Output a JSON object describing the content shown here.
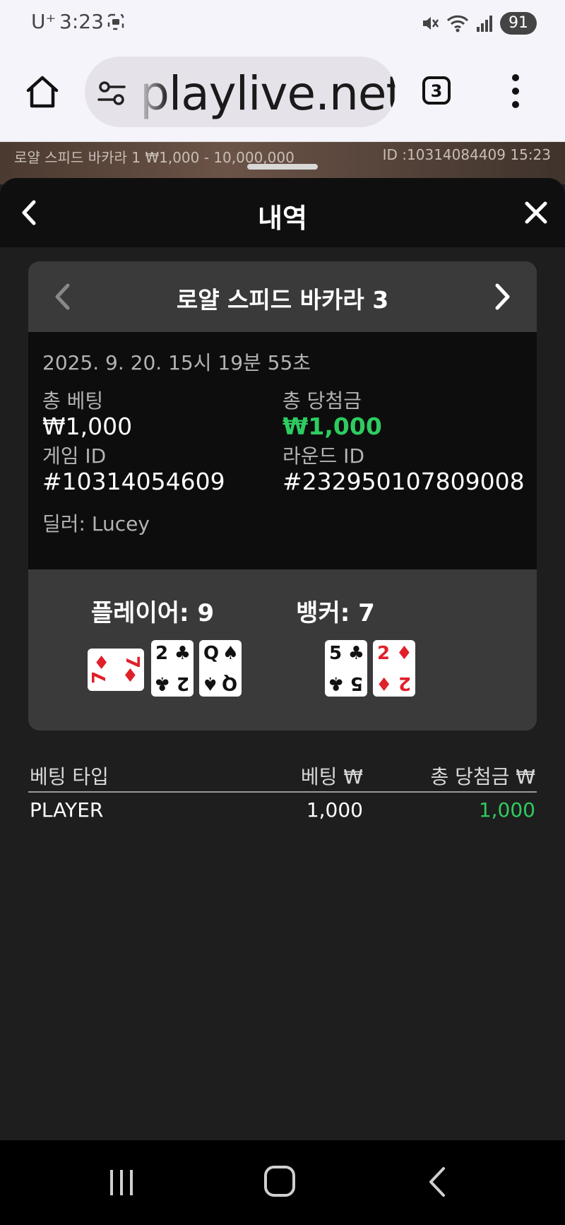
{
  "status_bar": {
    "carrier": "U⁺",
    "time": "3:23",
    "battery": "91"
  },
  "browser": {
    "url": "playlive.net",
    "tab_count": "3"
  },
  "game_strip": {
    "left_text": "로얄 스피드 바카라 1 ₩1,000 - 10,000,000",
    "right_text": "ID :10314084409 15:23"
  },
  "sheet": {
    "title": "내역"
  },
  "round": {
    "table_name": "로얄 스피드 바카라 3",
    "datetime": "2025. 9. 20. 15시 19분 55초",
    "total_bet_label": "총 베팅",
    "total_bet_value": "₩1,000",
    "total_win_label": "총 당첨금",
    "total_win_value": "₩1,000",
    "game_id_label": "게임 ID",
    "game_id_value": "#10314054609",
    "round_id_label": "라운드 ID",
    "round_id_value": "#232950107809008",
    "dealer": "딜러: Lucey"
  },
  "result": {
    "player_label": "플레이어: 9",
    "banker_label": "뱅커: 7",
    "player_cards": [
      {
        "rank": "7",
        "suit": "♦"
      },
      {
        "rank": "2",
        "suit": "♣"
      },
      {
        "rank": "Q",
        "suit": "♠"
      }
    ],
    "banker_cards": [
      {
        "rank": "5",
        "suit": "♣"
      },
      {
        "rank": "2",
        "suit": "♦"
      }
    ]
  },
  "bets": {
    "headers": [
      "베팅 타입",
      "베팅 ₩",
      "총 당첨금 ₩"
    ],
    "rows": [
      {
        "type": "PLAYER",
        "bet": "1,000",
        "win": "1,000"
      }
    ]
  },
  "colors": {
    "win_green": "#2ecc60",
    "card_red": "#e0202a"
  }
}
